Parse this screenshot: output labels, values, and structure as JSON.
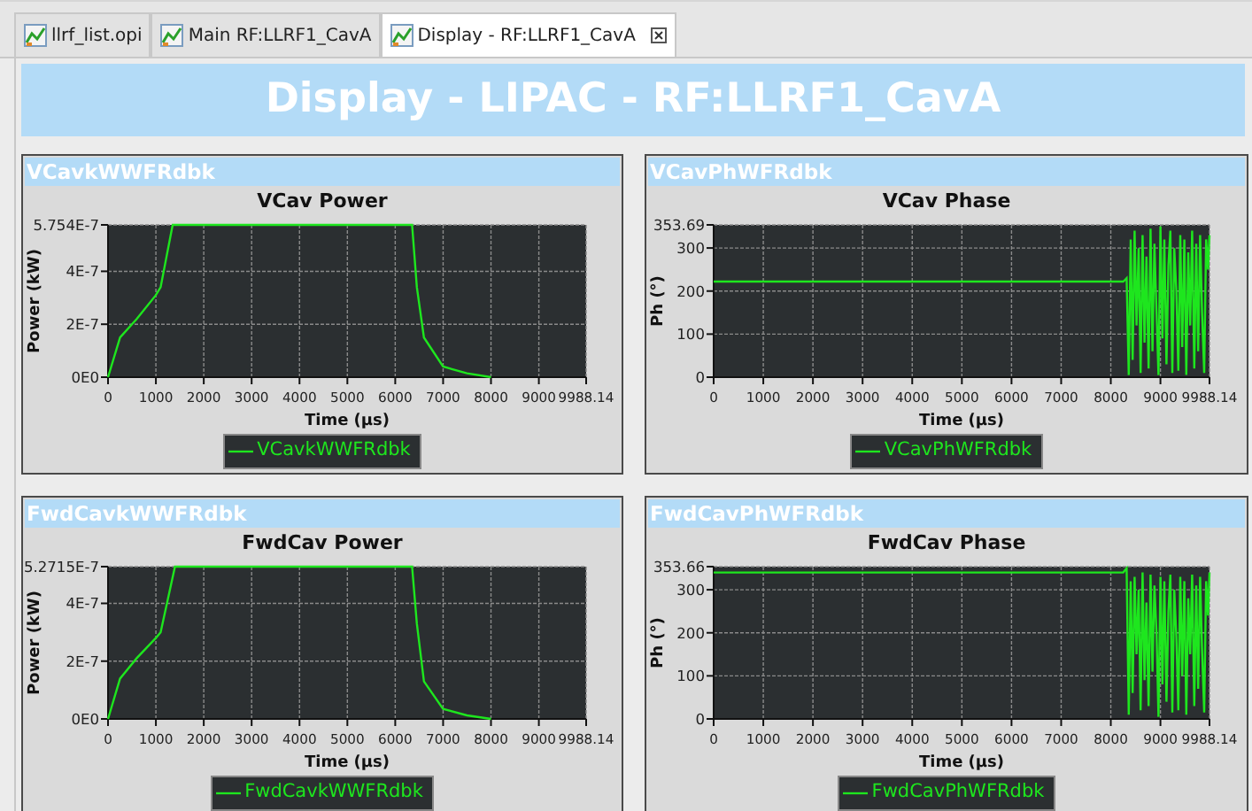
{
  "tabs": [
    {
      "label": "llrf_list.opi",
      "selected": false,
      "closable": false
    },
    {
      "label": "Main RF:LLRF1_CavA",
      "selected": false,
      "closable": false
    },
    {
      "label": "Display - RF:LLRF1_CavA",
      "selected": true,
      "closable": true
    }
  ],
  "banner": {
    "title": "Display - LIPAC - RF:LLRF1_CavA"
  },
  "panels": [
    {
      "header": "VCavkWWFRdbk",
      "chart_data": {
        "type": "line",
        "grid": true,
        "title": "VCav Power",
        "xlabel": "Time (µs)",
        "ylabel": "Power (kW)",
        "xlim": [
          0,
          9988.14
        ],
        "ylim": [
          0,
          5.754e-07
        ],
        "xticks": [
          0,
          1000,
          2000,
          3000,
          4000,
          5000,
          6000,
          7000,
          8000,
          9000,
          9988.14
        ],
        "yticks": [
          {
            "value": 0,
            "label": "0E0"
          },
          {
            "value": 2e-07,
            "label": "2E-7"
          },
          {
            "value": 4e-07,
            "label": "4E-7"
          },
          {
            "value": 5.754e-07,
            "label": "5.754E-7"
          }
        ],
        "x": [
          0,
          250,
          600,
          1000,
          1100,
          1350,
          6350,
          6450,
          6600,
          7000,
          7500,
          8000
        ],
        "series": [
          {
            "name": "VCavkWWFRdbk",
            "color": "#1ee61e",
            "values": [
              0,
              1.5e-07,
              2.2e-07,
              3.1e-07,
              3.4e-07,
              5.754e-07,
              5.754e-07,
              3.4e-07,
              1.5e-07,
              4e-08,
              1.5e-08,
              0
            ]
          }
        ]
      }
    },
    {
      "header": "VCavPhWFRdbk",
      "chart_data": {
        "type": "line",
        "grid": true,
        "title": "VCav Phase",
        "xlabel": "Time (µs)",
        "ylabel": "Ph (°)",
        "xlim": [
          0,
          9988.14
        ],
        "ylim": [
          0,
          353.69
        ],
        "xticks": [
          0,
          1000,
          2000,
          3000,
          4000,
          5000,
          6000,
          7000,
          8000,
          9000,
          9988.14
        ],
        "yticks": [
          0,
          100,
          200,
          300,
          {
            "value": 353.69,
            "label": "353.69"
          }
        ],
        "x": [
          0,
          8250,
          8320,
          8360,
          8400,
          8440,
          8480,
          8520,
          8560,
          8600,
          8640,
          8680,
          8720,
          8760,
          8800,
          8840,
          8880,
          8920,
          8960,
          9000,
          9040,
          9080,
          9120,
          9160,
          9200,
          9240,
          9280,
          9320,
          9360,
          9400,
          9440,
          9480,
          9520,
          9560,
          9600,
          9640,
          9680,
          9720,
          9760,
          9800,
          9840,
          9880,
          9920,
          9960,
          9988
        ],
        "series": [
          {
            "name": "VCavPhWFRdbk",
            "color": "#1ee61e",
            "values": [
              222,
              222,
              230,
              5,
              320,
              40,
              340,
              120,
              300,
              10,
              330,
              80,
              280,
              20,
              345,
              60,
              310,
              150,
              5,
              350,
              90,
              320,
              30,
              260,
              340,
              10,
              300,
              200,
              15,
              330,
              70,
              320,
              5,
              290,
              120,
              340,
              20,
              310,
              60,
              330,
              150,
              10,
              320,
              250,
              330
            ]
          }
        ]
      }
    },
    {
      "header": "FwdCavkWWFRdbk",
      "chart_data": {
        "type": "line",
        "grid": true,
        "title": "FwdCav Power",
        "xlabel": "Time (µs)",
        "ylabel": "Power (kW)",
        "xlim": [
          0,
          9988.14
        ],
        "ylim": [
          0,
          5.2715e-07
        ],
        "xticks": [
          0,
          1000,
          2000,
          3000,
          4000,
          5000,
          6000,
          7000,
          8000,
          9000,
          9988.14
        ],
        "yticks": [
          {
            "value": 0,
            "label": "0E0"
          },
          {
            "value": 2e-07,
            "label": "2E-7"
          },
          {
            "value": 4e-07,
            "label": "4E-7"
          },
          {
            "value": 5.2715e-07,
            "label": "5.2715E-7"
          }
        ],
        "x": [
          0,
          250,
          600,
          1000,
          1100,
          1400,
          6350,
          6450,
          6600,
          7000,
          7500,
          8000
        ],
        "series": [
          {
            "name": "FwdCavkWWFRdbk",
            "color": "#1ee61e",
            "values": [
              0,
              1.4e-07,
              2.1e-07,
              2.8e-07,
              3e-07,
              5.2715e-07,
              5.2715e-07,
              3.3e-07,
              1.3e-07,
              3.5e-08,
              1.2e-08,
              0
            ]
          }
        ]
      }
    },
    {
      "header": "FwdCavPhWFRdbk",
      "chart_data": {
        "type": "line",
        "grid": true,
        "title": "FwdCav Phase",
        "xlabel": "Time (µs)",
        "ylabel": "Ph (°)",
        "xlim": [
          0,
          9988.14
        ],
        "ylim": [
          0,
          353.66
        ],
        "xticks": [
          0,
          1000,
          2000,
          3000,
          4000,
          5000,
          6000,
          7000,
          8000,
          9000,
          9988.14
        ],
        "yticks": [
          0,
          100,
          200,
          300,
          {
            "value": 353.66,
            "label": "353.66"
          }
        ],
        "x": [
          0,
          8250,
          8320,
          8360,
          8400,
          8440,
          8480,
          8520,
          8560,
          8600,
          8640,
          8680,
          8720,
          8760,
          8800,
          8840,
          8880,
          8920,
          8960,
          9000,
          9040,
          9080,
          9120,
          9160,
          9200,
          9240,
          9280,
          9320,
          9360,
          9400,
          9440,
          9480,
          9520,
          9560,
          9600,
          9640,
          9680,
          9720,
          9760,
          9800,
          9840,
          9880,
          9920,
          9960,
          9988
        ],
        "series": [
          {
            "name": "FwdCavPhWFRdbk",
            "color": "#1ee61e",
            "values": [
              340,
              340,
              350,
              10,
              320,
              60,
              330,
              150,
              300,
              20,
              340,
              90,
              270,
              30,
              335,
              110,
              310,
              200,
              5,
              330,
              80,
              320,
              40,
              250,
              335,
              15,
              300,
              190,
              20,
              330,
              100,
              320,
              10,
              280,
              150,
              335,
              30,
              310,
              70,
              330,
              160,
              15,
              320,
              240,
              340
            ]
          }
        ]
      }
    }
  ]
}
